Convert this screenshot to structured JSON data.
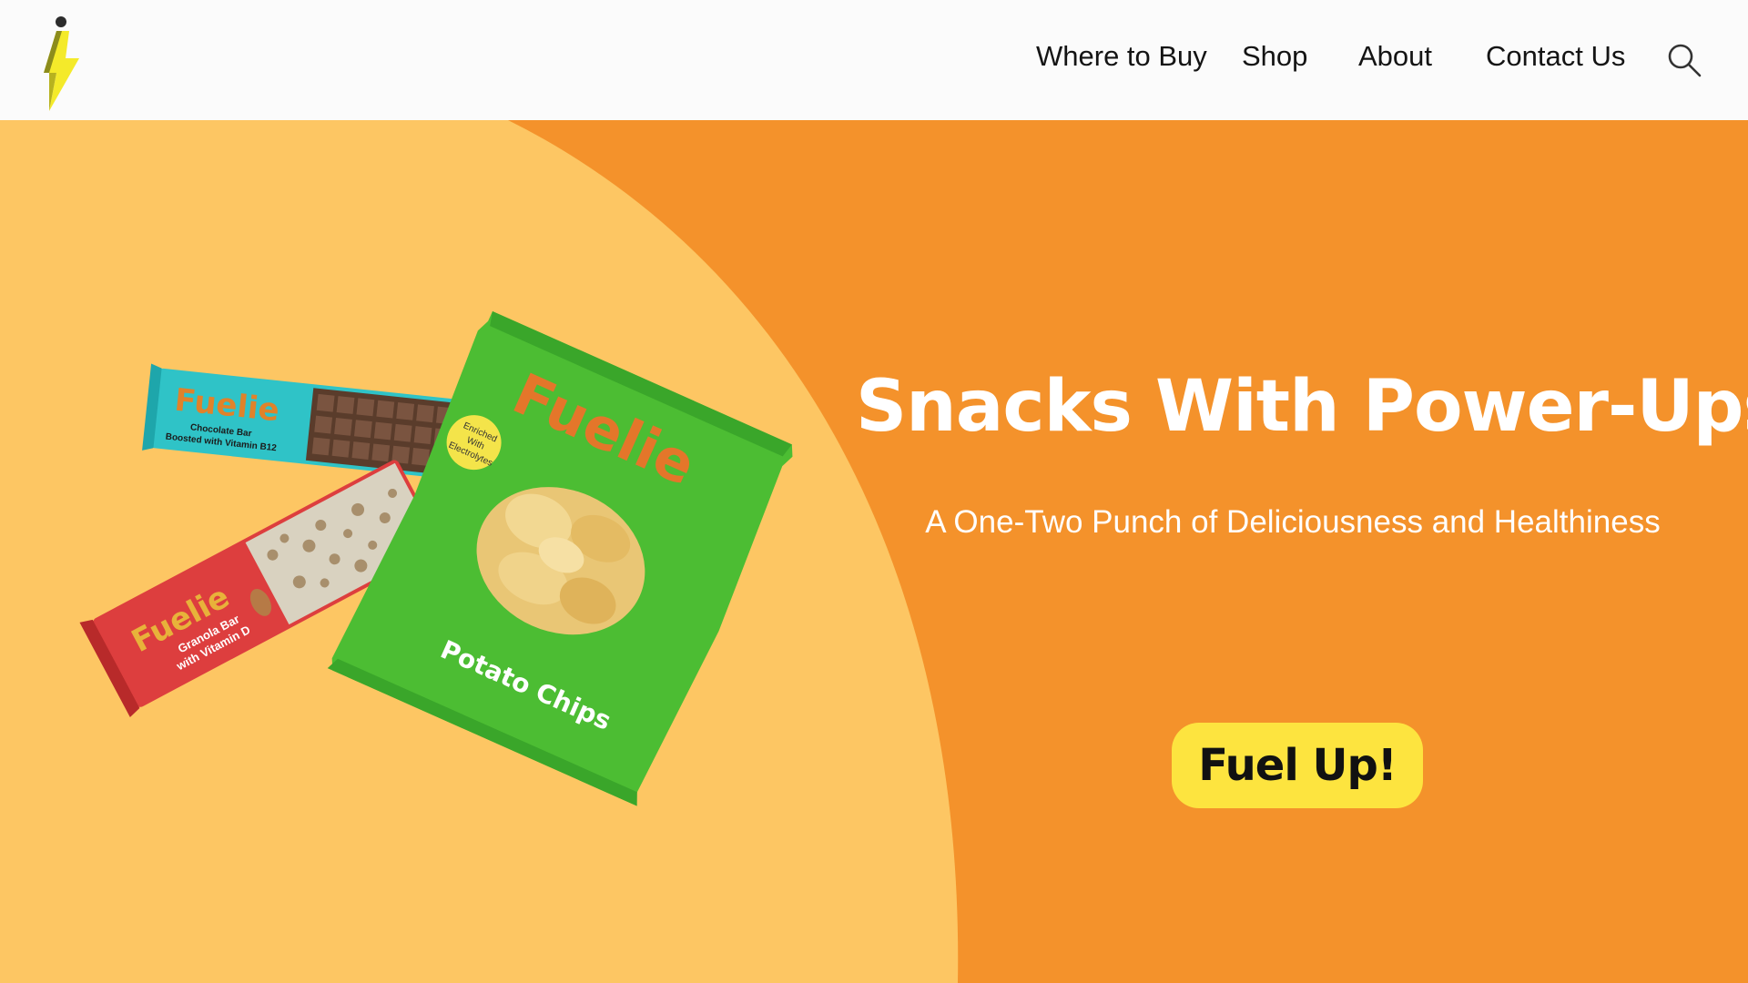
{
  "header": {
    "nav": [
      {
        "label": "Where to Buy"
      },
      {
        "label": "Shop"
      },
      {
        "label": "About"
      },
      {
        "label": "Contact Us"
      }
    ],
    "search_icon": "search-icon",
    "logo_icon": "lightning-person-logo"
  },
  "hero": {
    "title": "Snacks With Power-Ups",
    "subtitle": "A One-Two Punch of Deliciousness and Healthiness",
    "cta_label": "Fuel Up!",
    "colors": {
      "background": "#f4922b",
      "curve": "#fdc663",
      "button": "#fde43f"
    },
    "products": {
      "brand": "Fuelie",
      "chocolate_bar": {
        "line1": "Chocolate Bar",
        "line2": "Boosted with Vitamin B12"
      },
      "granola_bar": {
        "line1": "Granola Bar",
        "line2": "with Vitamin D"
      },
      "chips": {
        "name": "Potato Chips",
        "badge_line1": "Enriched",
        "badge_line2": "With",
        "badge_line3": "Electrolytes"
      }
    }
  }
}
